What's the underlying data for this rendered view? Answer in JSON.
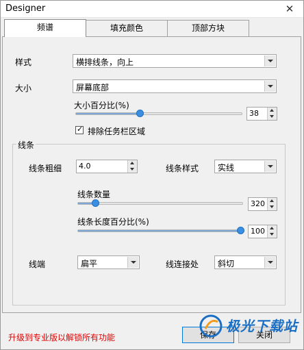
{
  "window": {
    "title": "Designer",
    "close_glyph": "✕"
  },
  "tabs": [
    {
      "label": "频谱",
      "active": true
    },
    {
      "label": "填充颜色",
      "active": false
    },
    {
      "label": "顶部方块",
      "active": false
    }
  ],
  "style_row": {
    "label": "样式",
    "value": "横排线条，向上"
  },
  "size_row": {
    "label": "大小",
    "value": "屏幕底部"
  },
  "size_percent": {
    "label": "大小百分比(%)",
    "value": "38",
    "fraction": 0.38
  },
  "taskbar": {
    "label": "排除任务栏区域",
    "checked": true,
    "check_glyph": "✓"
  },
  "lines_group": {
    "title": "线条",
    "thickness": {
      "label": "线条粗细",
      "value": "4.0"
    },
    "line_style": {
      "label": "线条样式",
      "value": "实线"
    },
    "count": {
      "label": "线条数量",
      "value": "320",
      "fraction": 0.09
    },
    "length_percent": {
      "label": "线条长度百分比(%)",
      "value": "100",
      "fraction": 1.0
    },
    "end": {
      "label": "线端",
      "value": "扁平"
    },
    "join": {
      "label": "线连接处",
      "value": "斜切"
    }
  },
  "footer": {
    "upgrade_text": "升级到专业版以解锁所有功能",
    "save_label": "保存",
    "close_label": "关闭",
    "upgrade_color": "#e00000"
  },
  "watermark": {
    "text": "极光下载站"
  },
  "colors": {
    "accent": "#3c8fe0",
    "upgrade": "#e00000"
  }
}
